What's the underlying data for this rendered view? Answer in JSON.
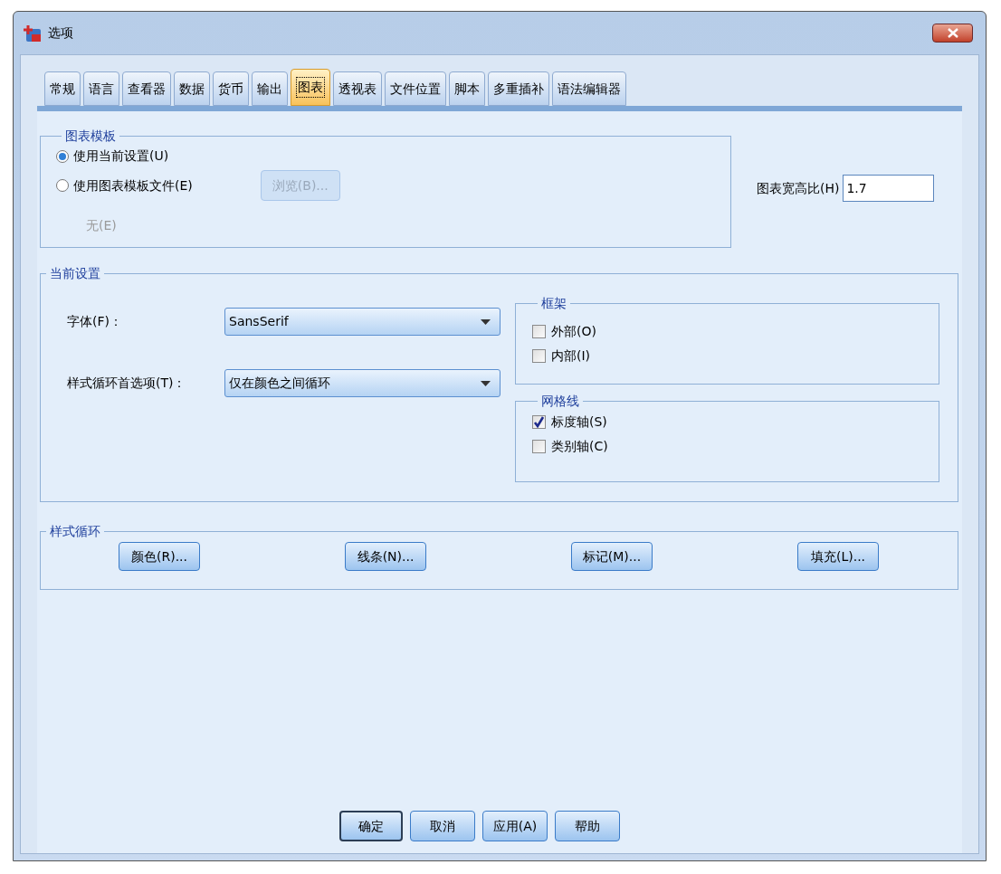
{
  "window": {
    "title": "选项"
  },
  "tabs": [
    {
      "label": "常规",
      "selected": false
    },
    {
      "label": "语言",
      "selected": false
    },
    {
      "label": "查看器",
      "selected": false
    },
    {
      "label": "数据",
      "selected": false
    },
    {
      "label": "货币",
      "selected": false
    },
    {
      "label": "输出",
      "selected": false
    },
    {
      "label": "图表",
      "selected": true
    },
    {
      "label": "透视表",
      "selected": false
    },
    {
      "label": "文件位置",
      "selected": false
    },
    {
      "label": "脚本",
      "selected": false
    },
    {
      "label": "多重插补",
      "selected": false
    },
    {
      "label": "语法编辑器",
      "selected": false
    }
  ],
  "chart_template": {
    "title": "图表模板",
    "options": [
      {
        "label": "使用当前设置(U)",
        "selected": true
      },
      {
        "label": "使用图表模板文件(E)",
        "selected": false
      }
    ],
    "browse_button": {
      "label": "浏览(B)...",
      "disabled": true
    },
    "file_label": {
      "text": "无(E)",
      "disabled": true
    }
  },
  "aspect_ratio": {
    "label": "图表宽高比(H)",
    "value": "1.7"
  },
  "current_settings": {
    "title": "当前设置",
    "fields": [
      {
        "label": "字体(F)：",
        "value": "SansSerif"
      },
      {
        "label": "样式循环首选项(T)：",
        "value": "仅在颜色之间循环"
      }
    ],
    "groups": [
      {
        "title": "框架",
        "items": [
          {
            "label": "外部(O)",
            "checked": false
          },
          {
            "label": "内部(I)",
            "checked": false
          }
        ]
      },
      {
        "title": "网格线",
        "items": [
          {
            "label": "标度轴(S)",
            "checked": true
          },
          {
            "label": "类别轴(C)",
            "checked": false
          }
        ]
      }
    ]
  },
  "style_cycles": {
    "title": "样式循环",
    "buttons": [
      "颜色(R)...",
      "线条(N)...",
      "标记(M)...",
      "填充(L)..."
    ]
  },
  "footer_buttons": [
    {
      "label": "确定",
      "default": true
    },
    {
      "label": "取消",
      "default": false
    },
    {
      "label": "应用(A)",
      "default": false
    },
    {
      "label": "帮助",
      "default": false
    }
  ]
}
